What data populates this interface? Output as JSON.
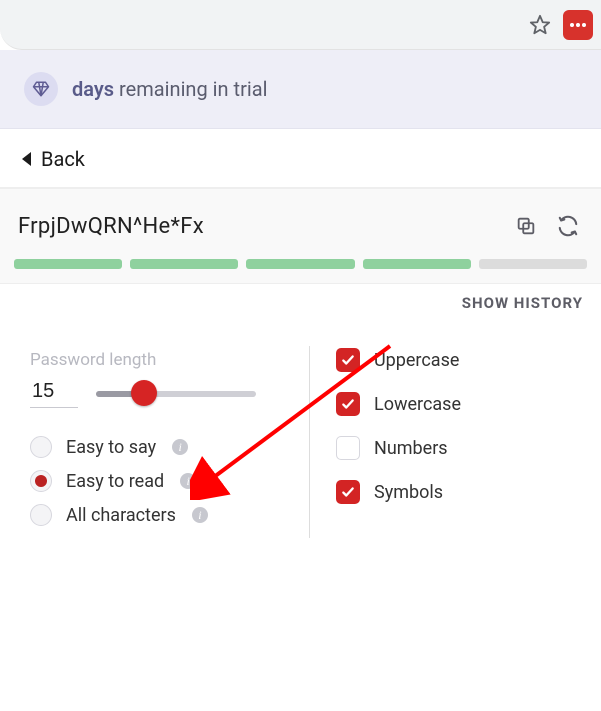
{
  "trial": {
    "days_word": "days",
    "rest": "remaining in trial"
  },
  "back_label": "Back",
  "password": "FrpjDwQRN^He*Fx",
  "strength_filled": 4,
  "strength_total": 5,
  "show_history": "SHOW HISTORY",
  "length": {
    "label": "Password length",
    "value": "15"
  },
  "radios": {
    "easy_say": "Easy to say",
    "easy_read": "Easy to read",
    "all_chars": "All characters",
    "selected": "easy_read"
  },
  "checks": {
    "uppercase": {
      "label": "Uppercase",
      "checked": true
    },
    "lowercase": {
      "label": "Lowercase",
      "checked": true
    },
    "numbers": {
      "label": "Numbers",
      "checked": false
    },
    "symbols": {
      "label": "Symbols",
      "checked": true
    }
  }
}
